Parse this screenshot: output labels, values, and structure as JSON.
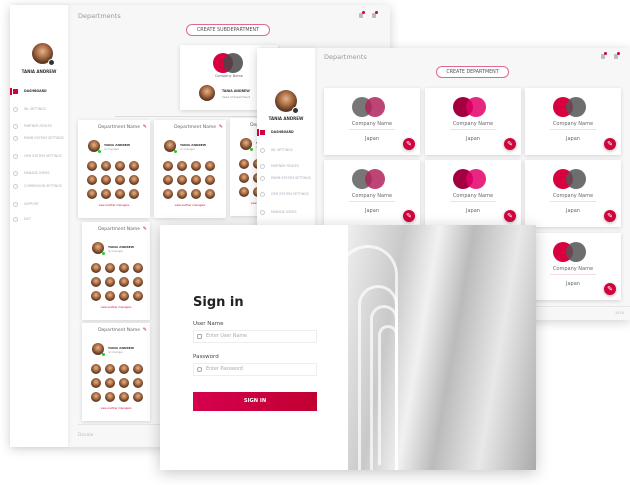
{
  "brand": {
    "accent": "#d0043c",
    "gray": "#555555"
  },
  "user": {
    "name": "TANIA ANDREW"
  },
  "back_window": {
    "title": "Departments",
    "create_button": "CREATE SUBDEPARTMENT",
    "top_card": {
      "company": "Company Name",
      "head_name": "TANIA ANDREW",
      "head_role": "head of department"
    },
    "dept_card": {
      "title": "Department Name",
      "manager": "TANIA ANDREW",
      "role": "lvl manager",
      "more_link": "view another managers"
    },
    "footer": "Dzvola",
    "nav": [
      {
        "label": "DASHBOARD",
        "icon": "dashboard-icon",
        "active": true
      },
      {
        "label": "WL SETTINGS",
        "icon": "globe-icon"
      },
      {
        "label": "PARTNER FENCES",
        "icon": "dollar-icon"
      },
      {
        "label": "PAMM SYSTEM SETTINGS",
        "icon": "users-icon"
      },
      {
        "label": "CRM SYSTEM SETTINGS",
        "icon": "briefcase-icon"
      },
      {
        "label": "MANAGE USERS",
        "icon": "user-icon"
      },
      {
        "label": "COMMISSION SETTINGS",
        "icon": "commission-icon"
      },
      {
        "label": "SUPPORT",
        "icon": "support-icon"
      },
      {
        "label": "EXIT",
        "icon": "exit-icon"
      }
    ]
  },
  "middle_window": {
    "title": "Departments",
    "create_button": "CREATE DEPARTMENT",
    "footer": "2018",
    "company_cards": [
      {
        "company": "Company Name",
        "location": "Japan",
        "colors": [
          "#777777",
          "#b0245e"
        ]
      },
      {
        "company": "Company Name",
        "location": "Japan",
        "colors": [
          "#a3003f",
          "#e3006a"
        ]
      },
      {
        "company": "Company Name",
        "location": "Japan",
        "colors": [
          "#d8003f",
          "#555555"
        ]
      },
      {
        "company": "Company Name",
        "location": "Japan",
        "colors": [
          "#777777",
          "#b0245e"
        ]
      },
      {
        "company": "Company Name",
        "location": "Japan",
        "colors": [
          "#a3003f",
          "#e3006a"
        ]
      },
      {
        "company": "Company Name",
        "location": "Japan",
        "colors": [
          "#d8003f",
          "#555555"
        ]
      },
      {
        "company": "Company Name",
        "location": "Japan",
        "colors": [
          "#d8003f",
          "#555555"
        ]
      }
    ]
  },
  "login": {
    "title": "Sign in",
    "username_label": "User Name",
    "username_placeholder": "Enter User Name",
    "password_label": "Password",
    "password_placeholder": "Enter  Password",
    "submit": "SIGN IN"
  }
}
